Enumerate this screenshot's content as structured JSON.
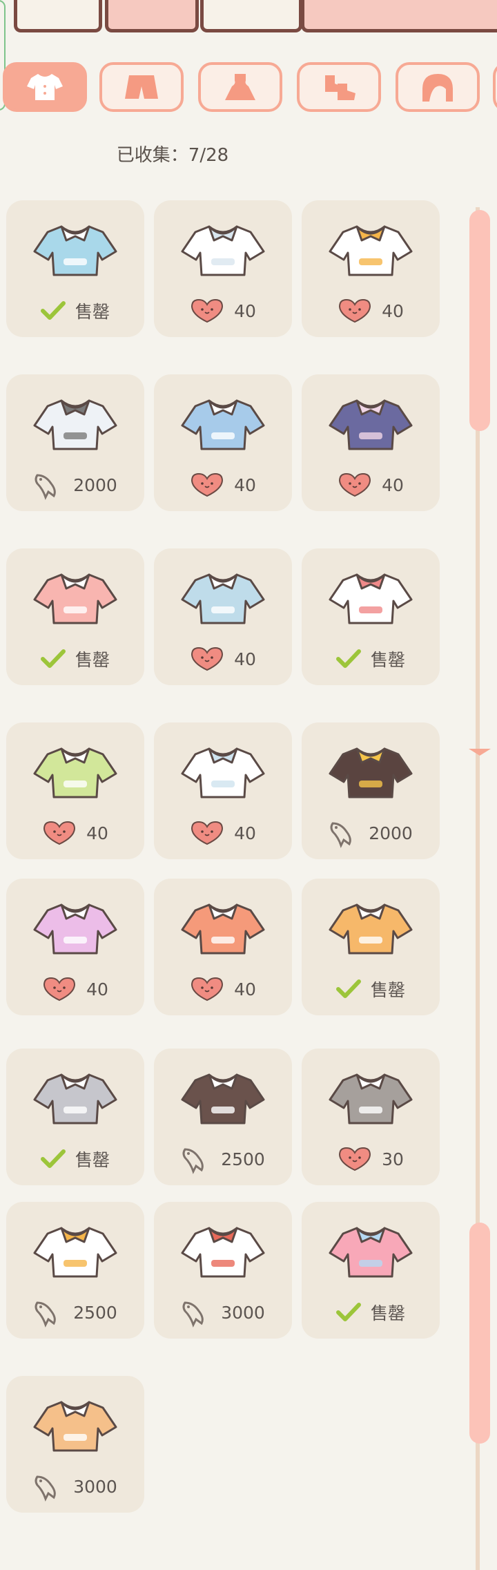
{
  "collected": {
    "label": "已收集：7/28"
  },
  "tabs": [
    {
      "name": "tab-tops",
      "icon": "shirt-icon",
      "active": true
    },
    {
      "name": "tab-bottoms",
      "icon": "shorts-icon",
      "active": false
    },
    {
      "name": "tab-dresses",
      "icon": "dress-icon",
      "active": false
    },
    {
      "name": "tab-shoes",
      "icon": "shoes-icon",
      "active": false
    },
    {
      "name": "tab-hair",
      "icon": "hair-icon",
      "active": false
    }
  ],
  "items": [
    {
      "currency": "sold",
      "value": "售罄",
      "colors": [
        "#a9d8ea",
        "#ffffff"
      ]
    },
    {
      "currency": "heart",
      "value": "40",
      "colors": [
        "#ffffff",
        "#d9e6ef"
      ]
    },
    {
      "currency": "heart",
      "value": "40",
      "colors": [
        "#ffffff",
        "#f5b54a"
      ]
    },
    {
      "currency": "fish",
      "value": "2000",
      "colors": [
        "#eef2f6",
        "#7a7a7a"
      ]
    },
    {
      "currency": "heart",
      "value": "40",
      "colors": [
        "#a7cbea",
        "#ffffff"
      ]
    },
    {
      "currency": "heart",
      "value": "40",
      "colors": [
        "#6b6aa0",
        "#f0d6e6"
      ]
    },
    {
      "currency": "sold",
      "value": "售罄",
      "colors": [
        "#f8b5b0",
        "#ffffff"
      ]
    },
    {
      "currency": "heart",
      "value": "40",
      "colors": [
        "#bfdcea",
        "#ffffff"
      ]
    },
    {
      "currency": "sold",
      "value": "售罄",
      "colors": [
        "#ffffff",
        "#f08a8a"
      ]
    },
    {
      "currency": "heart",
      "value": "40",
      "colors": [
        "#d2e79a",
        "#ffffff"
      ]
    },
    {
      "currency": "heart",
      "value": "40",
      "colors": [
        "#ffffff",
        "#cfe3ef"
      ]
    },
    {
      "currency": "fish",
      "value": "2000",
      "colors": [
        "#5a4440",
        "#f5c44a"
      ]
    },
    {
      "currency": "heart",
      "value": "40",
      "colors": [
        "#ecbde8",
        "#ffffff"
      ]
    },
    {
      "currency": "heart",
      "value": "40",
      "colors": [
        "#f59a7a",
        "#ffffff"
      ]
    },
    {
      "currency": "sold",
      "value": "售罄",
      "colors": [
        "#f6b86a",
        "#ffffff"
      ]
    },
    {
      "currency": "sold",
      "value": "售罄",
      "colors": [
        "#c6c6cc",
        "#ffffff"
      ]
    },
    {
      "currency": "fish",
      "value": "2500",
      "colors": [
        "#6a524c",
        "#ffffff"
      ]
    },
    {
      "currency": "heart",
      "value": "30",
      "colors": [
        "#a6a09c",
        "#ffffff"
      ]
    },
    {
      "currency": "fish",
      "value": "2500",
      "colors": [
        "#ffffff",
        "#f5b54a"
      ]
    },
    {
      "currency": "fish",
      "value": "3000",
      "colors": [
        "#ffffff",
        "#e86a5a"
      ]
    },
    {
      "currency": "sold",
      "value": "售罄",
      "colors": [
        "#f8a8b8",
        "#b5d8f2"
      ]
    },
    {
      "currency": "fish",
      "value": "3000",
      "colors": [
        "#f5c08a",
        "#ffffff"
      ]
    }
  ],
  "theme": {
    "accent": "#f7a994",
    "card": "#efe8dc",
    "background": "#f5f3ed",
    "heart": "#f08c82",
    "check": "#9cc53a",
    "fish": "#7e736c"
  }
}
